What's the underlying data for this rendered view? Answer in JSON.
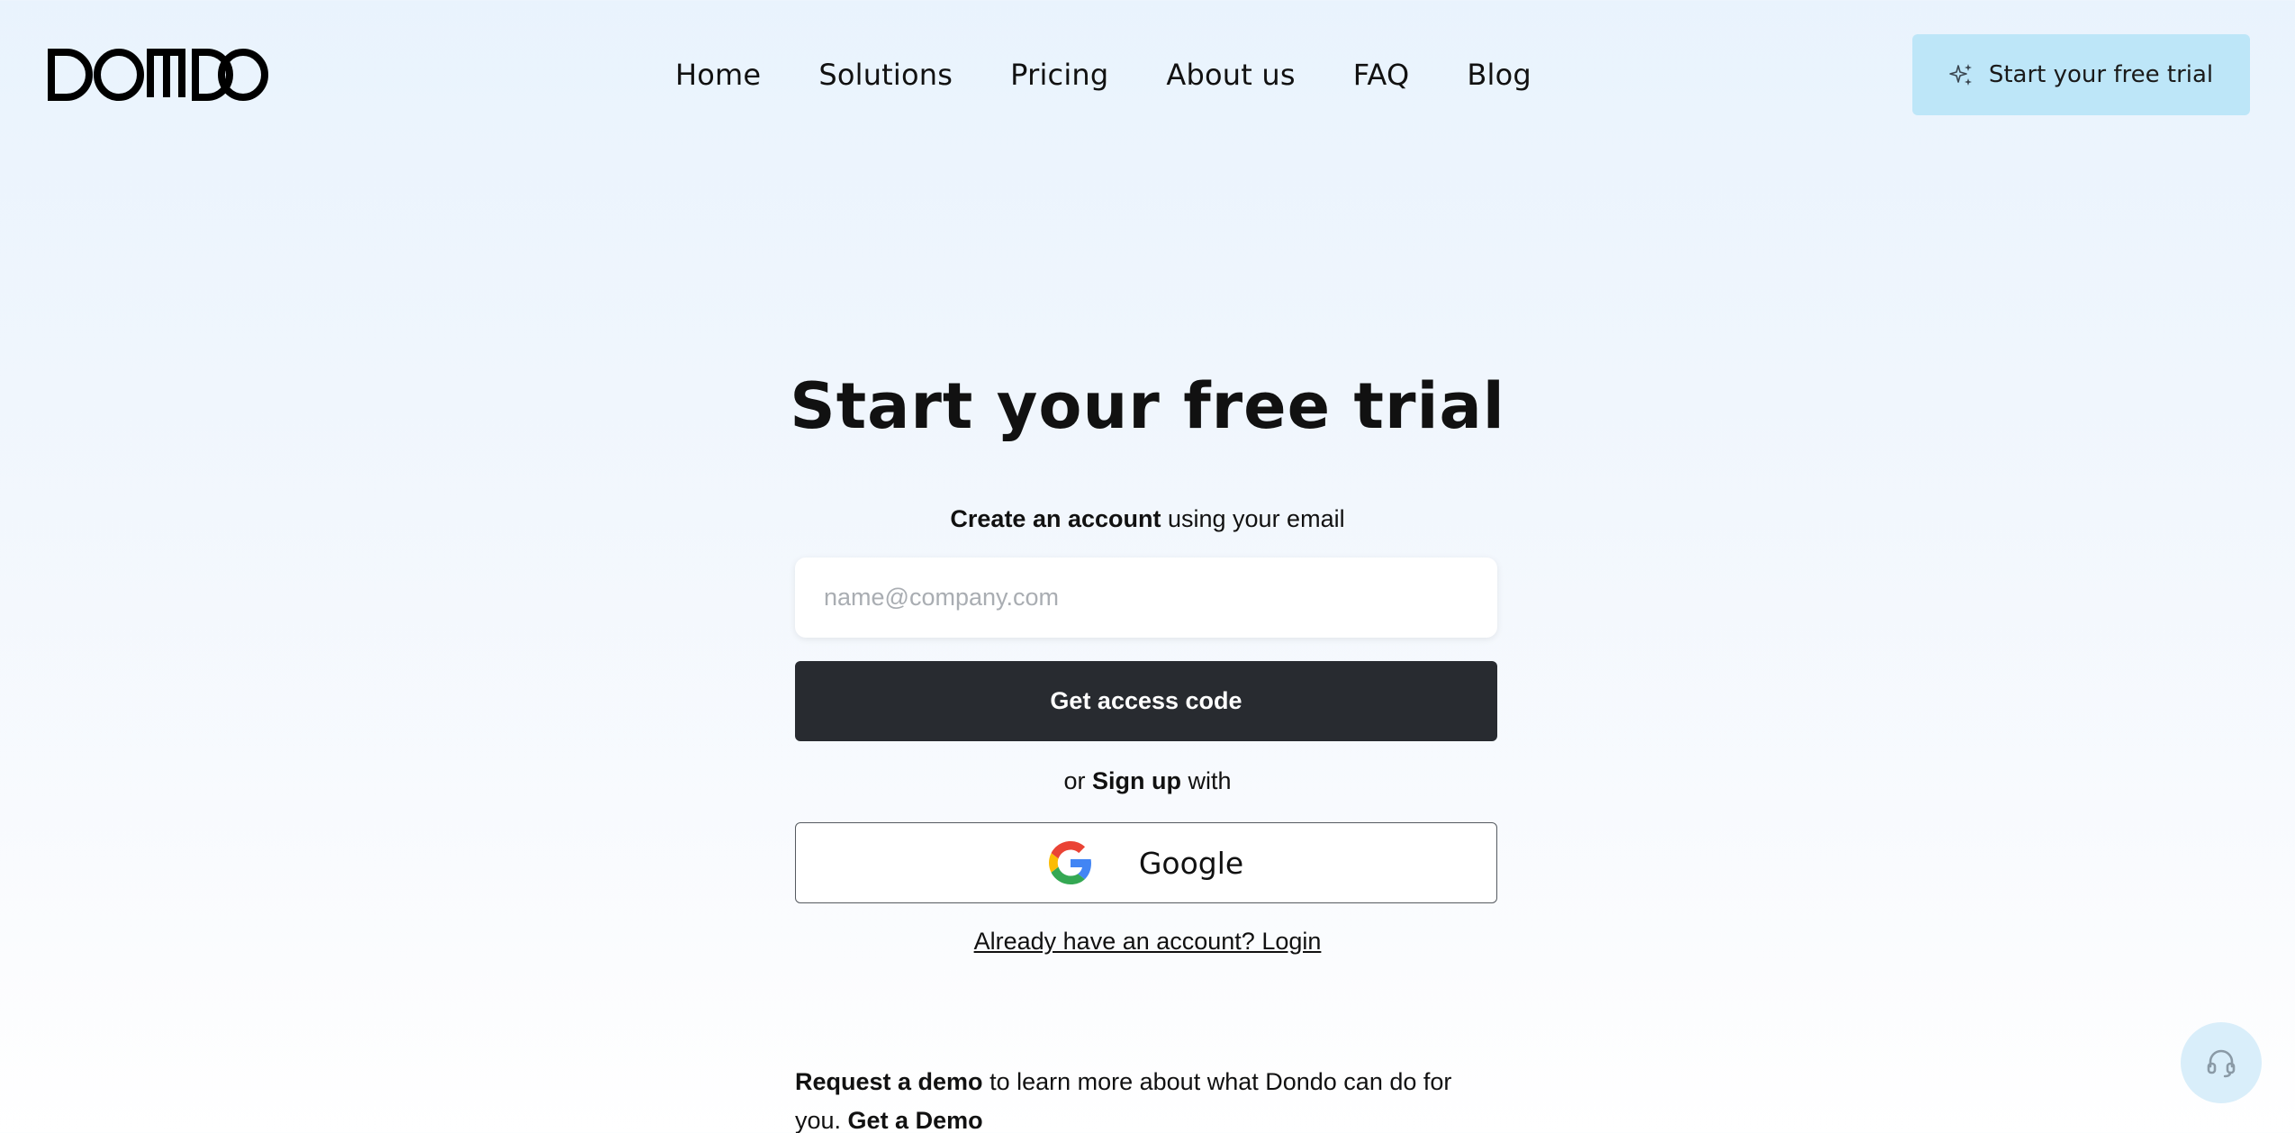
{
  "brand": {
    "name": "DONDO"
  },
  "nav": {
    "items": [
      {
        "label": "Home"
      },
      {
        "label": "Solutions"
      },
      {
        "label": "Pricing"
      },
      {
        "label": "About us"
      },
      {
        "label": "FAQ"
      },
      {
        "label": "Blog"
      }
    ]
  },
  "header_cta": {
    "label": "Start your free trial",
    "icon": "sparkle-icon",
    "bg_color": "#bde6f8"
  },
  "main": {
    "title": "Start your free trial",
    "subtitle_bold": "Create an account",
    "subtitle_rest": " using your email",
    "email": {
      "placeholder": "name@company.com",
      "value": ""
    },
    "access_button": {
      "label": "Get access code",
      "bg_color": "#282b30"
    },
    "or_prefix": "or ",
    "or_bold": "Sign up",
    "or_suffix": " with",
    "google_button": {
      "label": "Google",
      "icon": "google-icon"
    },
    "login_link": "Already have an account? Login",
    "demo": {
      "bold": "Request a demo",
      "text": " to learn more about what Dondo can do for you. ",
      "link": "Get a Demo"
    }
  },
  "support": {
    "icon": "headset-icon"
  }
}
